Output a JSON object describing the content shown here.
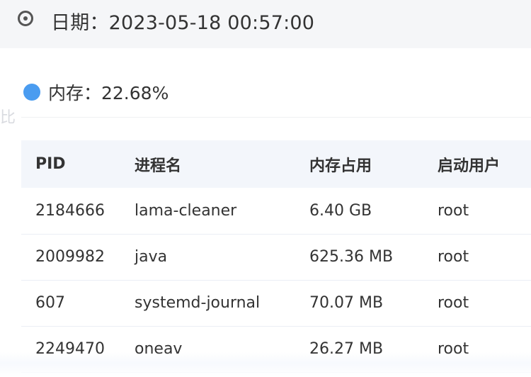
{
  "header": {
    "date_label": "日期：2023-05-18 00:57:00",
    "icon": "clock-icon"
  },
  "memory": {
    "label": "内存：22.68%",
    "dot_color": "#4a9cf0"
  },
  "ghost_text": "比",
  "table": {
    "columns": [
      "PID",
      "进程名",
      "内存占用",
      "启动用户"
    ],
    "rows": [
      [
        "2184666",
        "lama-cleaner",
        "6.40 GB",
        "root"
      ],
      [
        "2009982",
        "java",
        "625.36 MB",
        "root"
      ],
      [
        "607",
        "systemd-journal",
        "70.07 MB",
        "root"
      ],
      [
        "2249470",
        "oneav",
        "26.27 MB",
        "root"
      ]
    ]
  }
}
